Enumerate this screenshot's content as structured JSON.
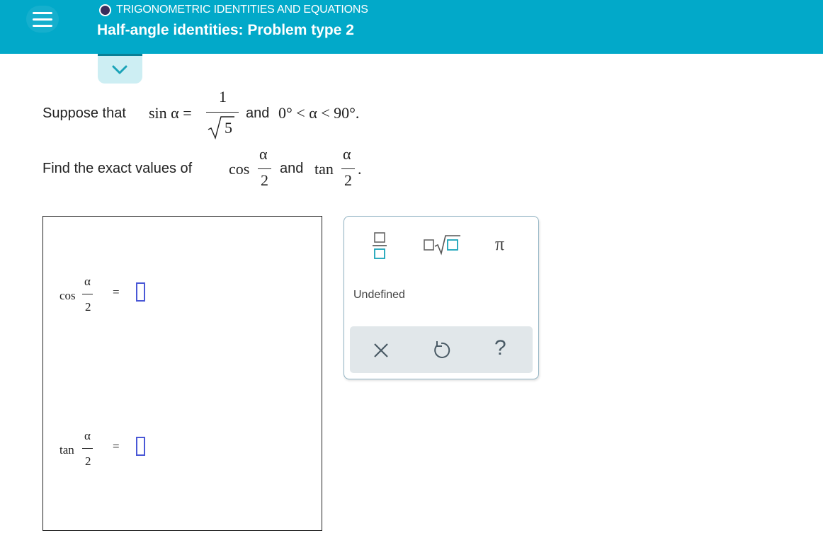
{
  "header": {
    "topic": "TRIGONOMETRIC IDENTITIES AND EQUATIONS",
    "title": "Half-angle identities: Problem type 2"
  },
  "problem": {
    "line1_lead": "Suppose that",
    "sin_func": "sin α =",
    "frac_num": "1",
    "frac_den": "5",
    "and1": "and",
    "range": "0° < α < 90°.",
    "line2_lead": "Find the exact values of",
    "cos_func": "cos",
    "alpha": "α",
    "two": "2",
    "and2": "and",
    "tan_func": "tan",
    "period": "."
  },
  "answers": [
    {
      "func": "cos",
      "num": "α",
      "den": "2",
      "eq": "="
    },
    {
      "func": "tan",
      "num": "α",
      "den": "2",
      "eq": "="
    }
  ],
  "keypad": {
    "pi_label": "π",
    "undefined_label": "Undefined",
    "clear_label": "×",
    "help_label": "?"
  },
  "colors": {
    "header_bg": "#02a9c9",
    "accent_dark": "#0a7f96",
    "slot_border": "#4a58d6",
    "keypad_teal": "#1aa3b8",
    "action_bar_bg": "#e1e7ea"
  },
  "icons": [
    "menu-icon",
    "chevron-down-icon",
    "fraction-icon",
    "sqrt-icon",
    "pi-icon",
    "clear-icon",
    "undo-icon",
    "help-icon"
  ]
}
